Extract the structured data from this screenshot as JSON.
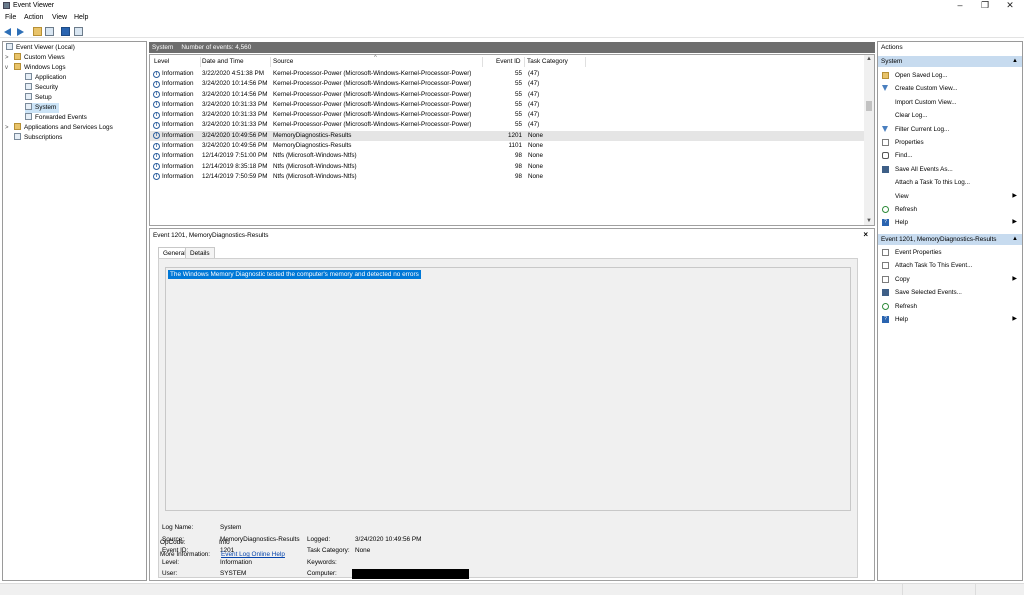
{
  "window": {
    "title": "Event Viewer"
  },
  "menu": [
    "File",
    "Action",
    "View",
    "Help"
  ],
  "tree": {
    "items": [
      {
        "label": "Event Viewer (Local)"
      },
      {
        "label": "Custom Views"
      },
      {
        "label": "Windows Logs"
      },
      {
        "label": "Application"
      },
      {
        "label": "Security"
      },
      {
        "label": "Setup"
      },
      {
        "label": "System"
      },
      {
        "label": "Forwarded Events"
      },
      {
        "label": "Applications and Services Logs"
      },
      {
        "label": "Subscriptions"
      }
    ]
  },
  "events_header": {
    "log": "System",
    "count_text": "Number of events: 4,560"
  },
  "columns": [
    "Level",
    "Date and Time",
    "Source",
    "Event ID",
    "Task Category"
  ],
  "events": [
    {
      "level": "Information",
      "date": "3/22/2020 4:51:38 PM",
      "source": "Kernel-Processor-Power (Microsoft-Windows-Kernel-Processor-Power)",
      "id": "55",
      "task": "(47)"
    },
    {
      "level": "Information",
      "date": "3/24/2020 10:14:56 PM",
      "source": "Kernel-Processor-Power (Microsoft-Windows-Kernel-Processor-Power)",
      "id": "55",
      "task": "(47)"
    },
    {
      "level": "Information",
      "date": "3/24/2020 10:14:56 PM",
      "source": "Kernel-Processor-Power (Microsoft-Windows-Kernel-Processor-Power)",
      "id": "55",
      "task": "(47)"
    },
    {
      "level": "Information",
      "date": "3/24/2020 10:31:33 PM",
      "source": "Kernel-Processor-Power (Microsoft-Windows-Kernel-Processor-Power)",
      "id": "55",
      "task": "(47)"
    },
    {
      "level": "Information",
      "date": "3/24/2020 10:31:33 PM",
      "source": "Kernel-Processor-Power (Microsoft-Windows-Kernel-Processor-Power)",
      "id": "55",
      "task": "(47)"
    },
    {
      "level": "Information",
      "date": "3/24/2020 10:31:33 PM",
      "source": "Kernel-Processor-Power (Microsoft-Windows-Kernel-Processor-Power)",
      "id": "55",
      "task": "(47)"
    },
    {
      "level": "Information",
      "date": "3/24/2020 10:49:56 PM",
      "source": "MemoryDiagnostics-Results",
      "id": "1201",
      "task": "None"
    },
    {
      "level": "Information",
      "date": "3/24/2020 10:49:56 PM",
      "source": "MemoryDiagnostics-Results",
      "id": "1101",
      "task": "None"
    },
    {
      "level": "Information",
      "date": "12/14/2019 7:51:00 PM",
      "source": "Ntfs (Microsoft-Windows-Ntfs)",
      "id": "98",
      "task": "None"
    },
    {
      "level": "Information",
      "date": "12/14/2019 8:35:18 PM",
      "source": "Ntfs (Microsoft-Windows-Ntfs)",
      "id": "98",
      "task": "None"
    },
    {
      "level": "Information",
      "date": "12/14/2019 7:50:59 PM",
      "source": "Ntfs (Microsoft-Windows-Ntfs)",
      "id": "98",
      "task": "None"
    }
  ],
  "detail": {
    "title": "Event 1201, MemoryDiagnostics-Results",
    "tabs": [
      "General",
      "Details"
    ],
    "description": "The Windows Memory Diagnostic tested the computer's memory and detected no errors",
    "fields": {
      "log_name_label": "Log Name:",
      "log_name": "System",
      "source_label": "Source:",
      "source": "MemoryDiagnostics-Results",
      "logged_label": "Logged:",
      "logged": "3/24/2020 10:49:56 PM",
      "event_id_label": "Event ID:",
      "event_id": "1201",
      "task_category_label": "Task Category:",
      "task_category": "None",
      "level_label": "Level:",
      "level": "Information",
      "keywords_label": "Keywords:",
      "user_label": "User:",
      "user": "SYSTEM",
      "computer_label": "Computer:",
      "opcode_label": "OpCode:",
      "opcode": "Info",
      "more_info_label": "More Information:",
      "more_info_link": "Event Log Online Help"
    }
  },
  "actions": {
    "title": "Actions",
    "section1": "System",
    "items1": [
      {
        "label": "Open Saved Log...",
        "icon": "folder-icon"
      },
      {
        "label": "Create Custom View...",
        "icon": "filter-icon"
      },
      {
        "label": "Import Custom View...",
        "icon": ""
      },
      {
        "label": "Clear Log...",
        "icon": ""
      },
      {
        "label": "Filter Current Log...",
        "icon": "filter-icon"
      },
      {
        "label": "Properties",
        "icon": "properties-icon"
      },
      {
        "label": "Find...",
        "icon": "find-icon"
      },
      {
        "label": "Save All Events As...",
        "icon": "save-icon"
      },
      {
        "label": "Attach a Task To this Log...",
        "icon": ""
      },
      {
        "label": "View",
        "icon": "",
        "submenu": "▶"
      },
      {
        "label": "Refresh",
        "icon": "refresh-icon"
      },
      {
        "label": "Help",
        "icon": "help-icon",
        "submenu": "▶"
      }
    ],
    "section2": "Event 1201, MemoryDiagnostics-Results",
    "items2": [
      {
        "label": "Event Properties",
        "icon": "properties-icon"
      },
      {
        "label": "Attach Task To This Event...",
        "icon": "task-icon"
      },
      {
        "label": "Copy",
        "icon": "copy-icon",
        "submenu": "▶"
      },
      {
        "label": "Save Selected Events...",
        "icon": "save-icon"
      },
      {
        "label": "Refresh",
        "icon": "refresh-icon"
      },
      {
        "label": "Help",
        "icon": "help-icon",
        "submenu": "▶"
      }
    ]
  }
}
